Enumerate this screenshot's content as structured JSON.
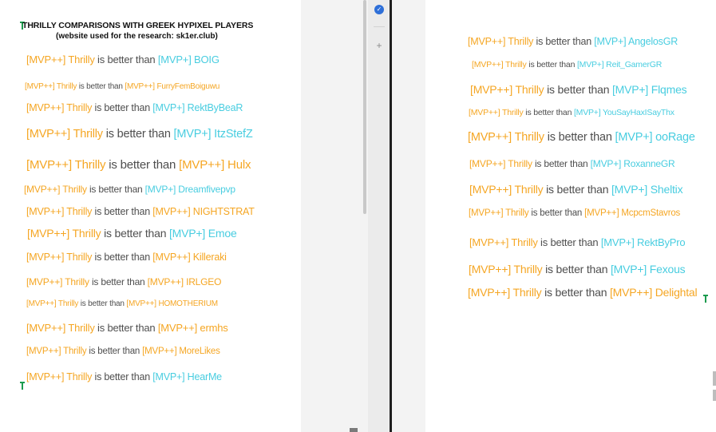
{
  "document": {
    "title": "THRILLY COMPARISONS WITH GREEK HYPIXEL PLAYERS",
    "subtitle": "(website used for the research: sk1er.club)"
  },
  "colors": {
    "mvp_plus_plus_rank": "#f5a623",
    "mvp_plus_rank": "#48cde0",
    "plus_sign": "#e8334a",
    "comparison_text": "#4f4f4f"
  },
  "comparison_phrase": "is better than",
  "player": {
    "rank": "[MVP++]",
    "name": "Thrilly"
  },
  "left_column": [
    {
      "rank": "[MVP+]",
      "name": "BOIG",
      "tier": "mvp_plus"
    },
    {
      "rank": "[MVP++]",
      "name": "FurryFemBoiguwu",
      "tier": "mvp_plus_plus"
    },
    {
      "rank": "[MVP+]",
      "name": "RektByBeaR",
      "tier": "mvp_plus"
    },
    {
      "rank": "[MVP+]",
      "name": "ItzStefZ",
      "tier": "mvp_plus"
    },
    {
      "rank": "[MVP++]",
      "name": "Hulx",
      "tier": "mvp_plus_plus"
    },
    {
      "rank": "[MVP+]",
      "name": "Dreamfivepvp",
      "tier": "mvp_plus"
    },
    {
      "rank": "[MVP++]",
      "name": "NIGHTSTRAT",
      "tier": "mvp_plus_plus"
    },
    {
      "rank": "[MVP+]",
      "name": "Emoe",
      "tier": "mvp_plus"
    },
    {
      "rank": "[MVP++]",
      "name": "Killeraki",
      "tier": "mvp_plus_plus"
    },
    {
      "rank": "[MVP++]",
      "name": "IRLGEO",
      "tier": "mvp_plus_plus"
    },
    {
      "rank": "[MVP++]",
      "name": "HOMOTHERIUM",
      "tier": "mvp_plus_plus"
    },
    {
      "rank": "[MVP++]",
      "name": "ermhs",
      "tier": "mvp_plus_plus"
    },
    {
      "rank": "[MVP++]",
      "name": "MoreLikes",
      "tier": "mvp_plus_plus"
    },
    {
      "rank": "[MVP+]",
      "name": "HearMe",
      "tier": "mvp_plus"
    }
  ],
  "right_column": [
    {
      "rank": "[MVP+]",
      "name": "AngelosGR",
      "tier": "mvp_plus"
    },
    {
      "rank": "[MVP+]",
      "name": "Reit_GamerGR",
      "tier": "mvp_plus"
    },
    {
      "rank": "[MVP+]",
      "name": "Flqmes",
      "tier": "mvp_plus"
    },
    {
      "rank": "[MVP+]",
      "name": "YouSayHaxISayThx",
      "tier": "mvp_plus"
    },
    {
      "rank": "[MVP+]",
      "name": "ooRage",
      "tier": "mvp_plus"
    },
    {
      "rank": "[MVP+]",
      "name": "RoxanneGR",
      "tier": "mvp_plus"
    },
    {
      "rank": "[MVP+]",
      "name": "Sheltix",
      "tier": "mvp_plus"
    },
    {
      "rank": "[MVP++]",
      "name": "McpcmStavros",
      "tier": "mvp_plus_plus"
    },
    {
      "rank": "[MVP+]",
      "name": "RektByPro",
      "tier": "mvp_plus"
    },
    {
      "rank": "[MVP+]",
      "name": "Fexous",
      "tier": "mvp_plus"
    },
    {
      "rank": "[MVP++]",
      "name": "Delightal",
      "tier": "mvp_plus_plus"
    }
  ],
  "icons": {
    "check": "check-circle-icon",
    "plus": "plus-icon",
    "check_glyph": "✓",
    "plus_glyph": "+"
  }
}
